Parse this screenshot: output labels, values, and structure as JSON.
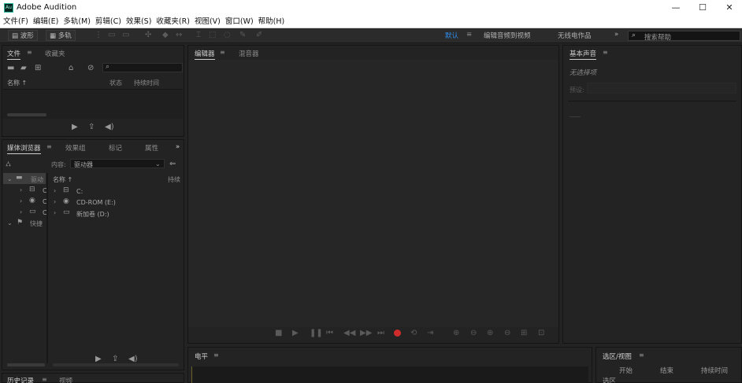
{
  "window": {
    "title": "Adobe Audition",
    "app_icon_text": "Au",
    "controls": {
      "minimize": "—",
      "maximize": "☐",
      "close": "✕"
    }
  },
  "menu": [
    "文件(F)",
    "编辑(E)",
    "多轨(M)",
    "剪辑(C)",
    "效果(S)",
    "收藏夹(R)",
    "视图(V)",
    "窗口(W)",
    "帮助(H)"
  ],
  "toolbar": {
    "waveform_label": "波形",
    "multitrack_label": "多轨",
    "workspaces": {
      "default": "默认",
      "edit_video": "编辑音频到视频",
      "radio": "无线电作品",
      "more": "»"
    },
    "search_placeholder": "搜索帮助"
  },
  "files_panel": {
    "tabs": [
      "文件",
      "收藏夹"
    ],
    "columns": {
      "name": "名称 ↑",
      "status": "状态",
      "duration": "持续时间"
    }
  },
  "media_panel": {
    "tabs": [
      "媒体浏览器",
      "效果组",
      "标记",
      "属性"
    ],
    "content_label": "内容:",
    "content_value": "驱动器",
    "left_tree": [
      "驱动",
      "C",
      "C",
      "C",
      "快捷"
    ],
    "columns": {
      "name": "名称 ↑",
      "duration": "持续"
    },
    "drives": [
      "C:",
      "CD-ROM (E:)",
      "新加卷 (D:)"
    ]
  },
  "editor_panel": {
    "tabs": [
      "编辑器",
      "混音器"
    ]
  },
  "essential_sound": {
    "title": "基本声音",
    "no_selection": "无选择项",
    "preset_label": "预设:"
  },
  "level_panel": {
    "title": "电平"
  },
  "selection_panel": {
    "title": "选区/视图",
    "columns": {
      "start": "开始",
      "end": "结束",
      "duration": "持续时间"
    },
    "row_label": "选区"
  },
  "history_panel": {
    "tabs": [
      "历史记录",
      "视频"
    ]
  },
  "colors": {
    "accent": "#2d8ceb",
    "record": "#d02b2b",
    "panel_bg": "#232323"
  }
}
